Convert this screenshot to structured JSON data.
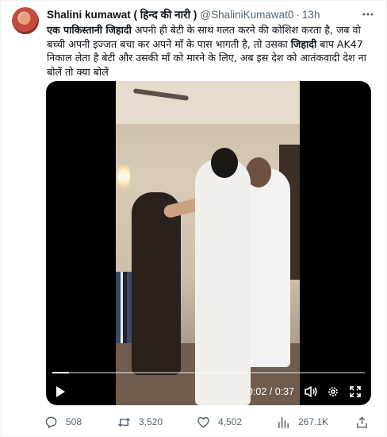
{
  "tweet": {
    "author": {
      "display_name": "Shalini kumawat ( हिन्द की नारी )",
      "handle": "@ShaliniKumawat0",
      "separator": "·",
      "time": "13h"
    },
    "more_icon": "more-horizontal-icon",
    "text": {
      "seg1_bold": "एक पाकिस्तानी जिहादी",
      "seg2": " अपनी ही बेटी के साथ गलत करने की कोशिश करता है, जब वो बच्ची अपनी इज्जत बचा कर अपने माँ के पास भागती है, तो उसका ",
      "seg3_bold": "जिहादी",
      "seg4": " बाप AK47 निकाल लेता है बेटी और उसकी माँ को मारने के लिए, अब इस देश को आतंकवादी देश ना बोलें तो क्या बोलें"
    },
    "video": {
      "current_time": "0:02",
      "duration": "0:37",
      "time_display": "0:02 / 0:37",
      "progress_fraction": 0.054,
      "controls": [
        "play-icon",
        "volume-icon",
        "settings-icon",
        "fullscreen-icon"
      ]
    },
    "actions": {
      "replies": "508",
      "retweets": "3,520",
      "likes": "4,502",
      "views": "267.1K"
    }
  },
  "colors": {
    "text_primary": "#0f1419",
    "text_secondary": "#536471",
    "border": "#eff3f4"
  }
}
